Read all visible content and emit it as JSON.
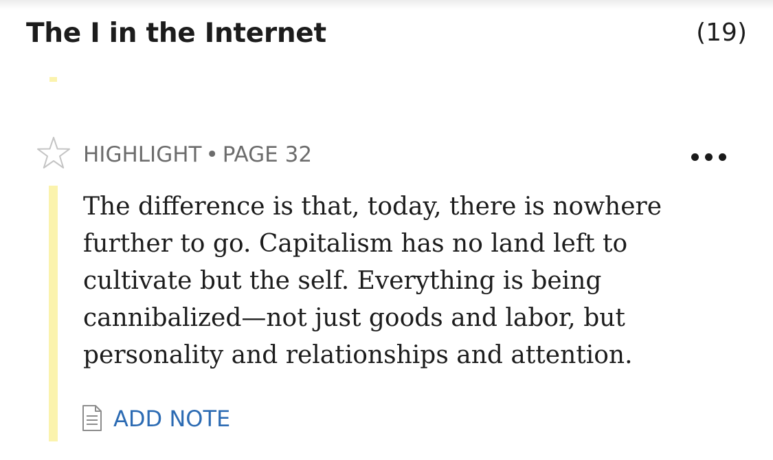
{
  "header": {
    "title": "The I in the Internet",
    "count": "(19)"
  },
  "highlight": {
    "type_label": "HIGHLIGHT",
    "separator": "•",
    "page_label": "PAGE 32",
    "text": "The difference is that, today, there is nowhere further to go. Capitalism has no land left to cultivate but the self. Everything is being cannibalized—not just goods and labor, but personality and relationships and attention.",
    "highlight_color": "#fbf3ad",
    "add_note_label": "ADD NOTE",
    "add_note_color": "#2c6bb3"
  },
  "icons": {
    "favorite": "star-outline-icon",
    "more": "more-horizontal-icon",
    "note": "note-document-icon"
  }
}
